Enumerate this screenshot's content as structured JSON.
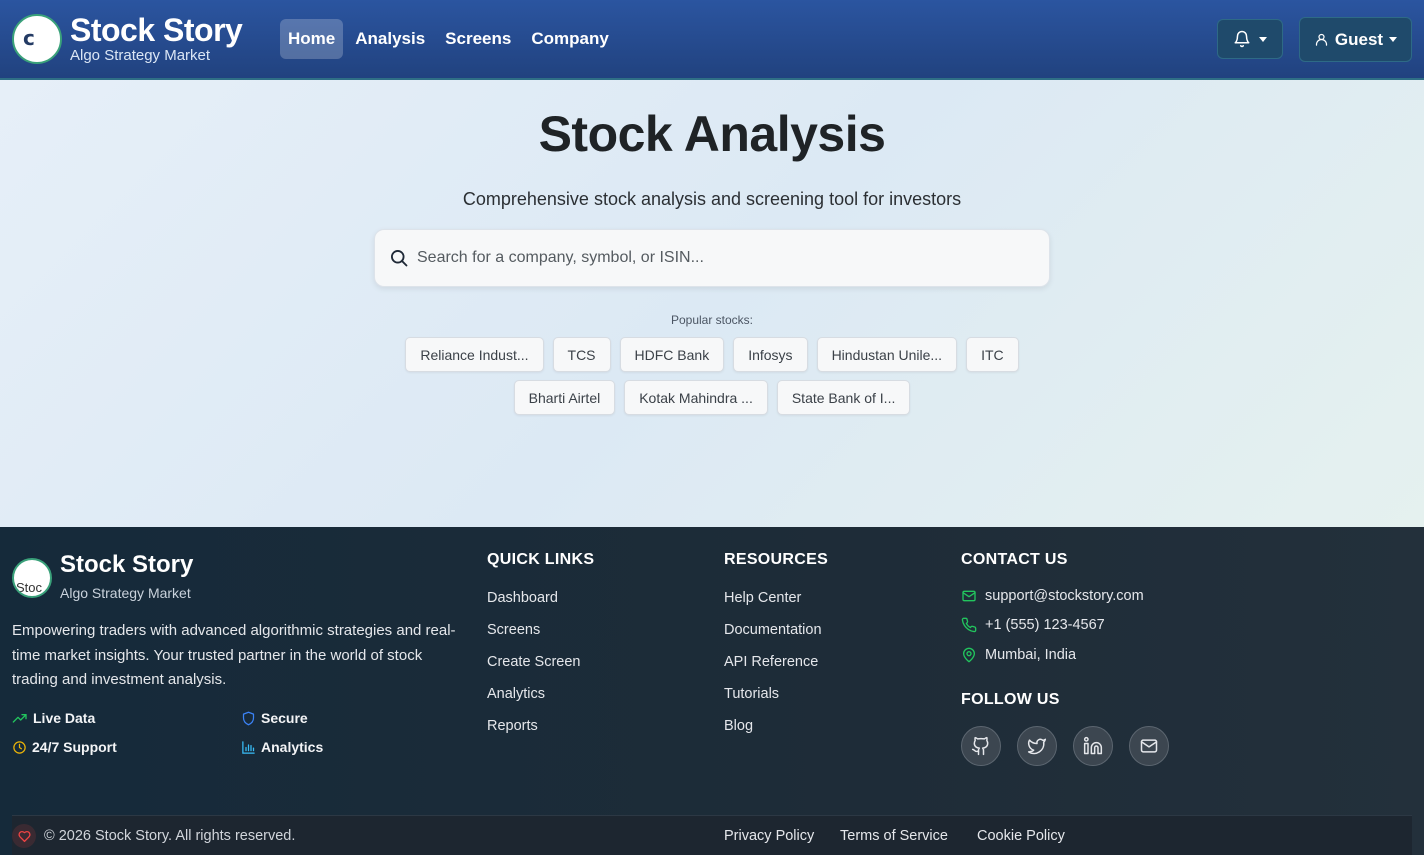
{
  "header": {
    "brand_title": "Stock Story",
    "brand_subtitle": "Algo Strategy Market",
    "logo_alt": "c",
    "nav": [
      {
        "label": "Home",
        "active": true
      },
      {
        "label": "Analysis",
        "active": false
      },
      {
        "label": "Screens",
        "active": false
      },
      {
        "label": "Company",
        "active": false
      }
    ],
    "user_label": "Guest"
  },
  "hero": {
    "title": "Stock Analysis",
    "subtitle": "Comprehensive stock analysis and screening tool for investors",
    "search_placeholder": "Search for a company, symbol, or ISIN...",
    "popular_label": "Popular stocks:",
    "popular_row1": [
      "Reliance Indust...",
      "TCS",
      "HDFC Bank",
      "Infosys",
      "Hindustan Unile...",
      "ITC"
    ],
    "popular_row2": [
      "Bharti Airtel",
      "Kotak Mahindra ...",
      "State Bank of I..."
    ]
  },
  "footer": {
    "brand_title": "Stock Story",
    "brand_subtitle": "Algo Strategy Market",
    "logo_alt": "Stoc",
    "description": "Empowering traders with advanced algorithmic strategies and real-time market insights. Your trusted partner in the world of stock trading and investment analysis.",
    "features": {
      "live_data": "Live Data",
      "secure": "Secure",
      "support": "24/7 Support",
      "analytics": "Analytics"
    },
    "quick_links": {
      "heading": "QUICK LINKS",
      "items": [
        "Dashboard",
        "Screens",
        "Create Screen",
        "Analytics",
        "Reports"
      ]
    },
    "resources": {
      "heading": "RESOURCES",
      "items": [
        "Help Center",
        "Documentation",
        "API Reference",
        "Tutorials",
        "Blog"
      ]
    },
    "contact": {
      "heading": "CONTACT US",
      "email": "support@stockstory.com",
      "phone": "+1 (555) 123-4567",
      "location": "Mumbai, India"
    },
    "follow_heading": "FOLLOW US",
    "copyright": "© 2026 Stock Story. All rights reserved.",
    "legal": {
      "privacy": "Privacy Policy",
      "terms": "Terms of Service",
      "cookie": "Cookie Policy"
    }
  },
  "colors": {
    "nav_bg": "#2b55a0",
    "footer_bg": "#1e2c38",
    "accent_green": "#22c55e",
    "accent_blue": "#3b82f6",
    "accent_yellow": "#eab308"
  }
}
